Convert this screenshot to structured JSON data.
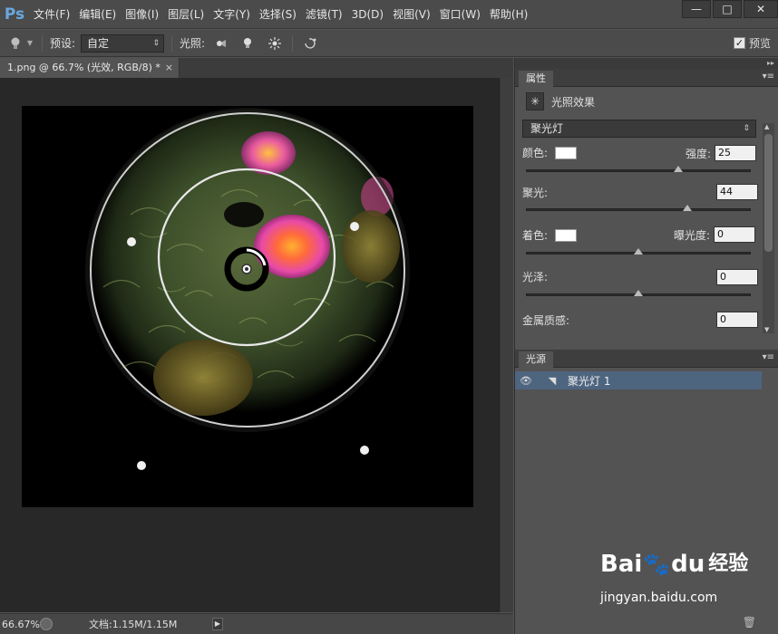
{
  "app": {
    "logo": "Ps"
  },
  "menu": [
    "文件(F)",
    "编辑(E)",
    "图像(I)",
    "图层(L)",
    "文字(Y)",
    "选择(S)",
    "滤镜(T)",
    "3D(D)",
    "视图(V)",
    "窗口(W)",
    "帮助(H)"
  ],
  "window_controls": {
    "minimize": "—",
    "maximize": "□",
    "close": "✕"
  },
  "options": {
    "preset_label": "预设:",
    "preset_value": "自定",
    "lights_label": "光照:",
    "preview_label": "预览",
    "preview_checked": true
  },
  "document": {
    "tab_title": "1.png @ 66.7% (光效, RGB/8) *",
    "close": "×"
  },
  "status": {
    "zoom": "66.67%",
    "doc_info": "文档:1.15M/1.15M"
  },
  "properties": {
    "tab": "属性",
    "title": "光照效果",
    "light_type": "聚光灯",
    "color_label": "颜色:",
    "color_value": "#ffffff",
    "intensity_label": "强度:",
    "intensity": "25",
    "intensity_fraction": 0.68,
    "hotspot_label": "聚光:",
    "hotspot": "44",
    "hotspot_fraction": 0.72,
    "colorize_label": "着色:",
    "colorize_value": "#ffffff",
    "exposure_label": "曝光度:",
    "exposure": "0",
    "exposure_fraction": 0.5,
    "gloss_label": "光泽:",
    "gloss": "0",
    "gloss_fraction": 0.5,
    "metallic_label": "金属质感:",
    "metallic": "0"
  },
  "lights_panel": {
    "tab": "光源",
    "items": [
      {
        "name": "聚光灯 1"
      }
    ]
  },
  "watermark": {
    "brand": "Bai",
    "brand2": "du",
    "cn": "经验",
    "url": "jingyan.baidu.com"
  },
  "colors": {
    "accent_selection": "#4e6580",
    "panel_bg": "#535353",
    "canvas_bg": "#282828"
  }
}
